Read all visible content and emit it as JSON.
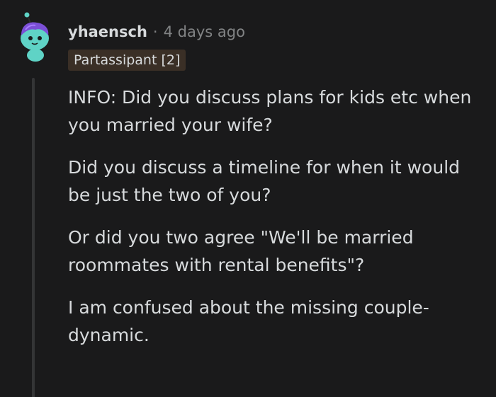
{
  "comment": {
    "author": "yhaensch",
    "separator": "·",
    "timestamp": "4 days ago",
    "flair": "Partassipant [2]",
    "paragraphs": [
      "INFO: Did you discuss plans for kids etc when you married your wife?",
      "Did you discuss a timeline for when it would be just the two of you?",
      "Or did you two agree \"We'll be married roommates with rental benefits\"?",
      "I am confused about the missing couple-dynamic."
    ]
  },
  "colors": {
    "background": "#1a1a1b",
    "text": "#d7dadc",
    "meta": "#818384",
    "flair_bg": "#3a2f26",
    "avatar_face": "#5fd3c6",
    "avatar_hair": "#7b4fd6"
  },
  "icons": {
    "avatar": "snoo-avatar-icon"
  }
}
